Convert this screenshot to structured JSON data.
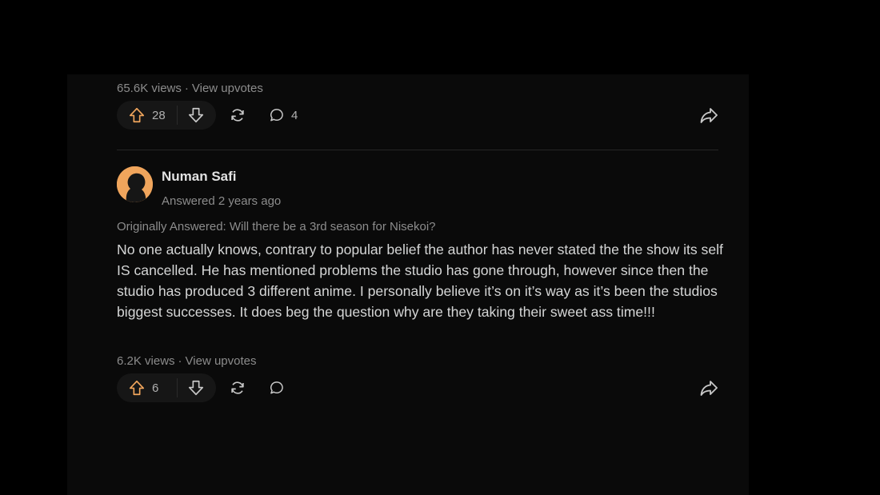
{
  "post1": {
    "stats": {
      "views": "65.6K views",
      "separator": "·",
      "upvotes_link": "View upvotes"
    },
    "actions": {
      "upvote_count": "28",
      "comment_count": "4"
    }
  },
  "post2": {
    "author": {
      "name": "Numan Safi",
      "answered": "Answered 2 years ago"
    },
    "original_question": "Originally Answered: Will there be a 3rd season for Nisekoi?",
    "body": "No one actually knows, contrary to popular belief the author has never stated the the show its self IS cancelled. He has mentioned problems the studio has gone through, however since then the studio has produced 3 different anime. I personally believe it’s on it’s way as it’s been the studios biggest successes. It does beg the question why are they taking their sweet ass time!!!",
    "stats": {
      "views": "6.2K views",
      "separator": "·",
      "upvotes_link": "View upvotes"
    },
    "actions": {
      "upvote_count": "6",
      "comment_count": ""
    }
  },
  "colors": {
    "upvote_accent": "#f0a55c",
    "background": "#000000",
    "icon": "#c8c8c8"
  },
  "icons": [
    "arrow-up-icon",
    "arrow-down-icon",
    "share-cycle-icon",
    "comment-bubble-icon",
    "forward-arrow-icon"
  ]
}
